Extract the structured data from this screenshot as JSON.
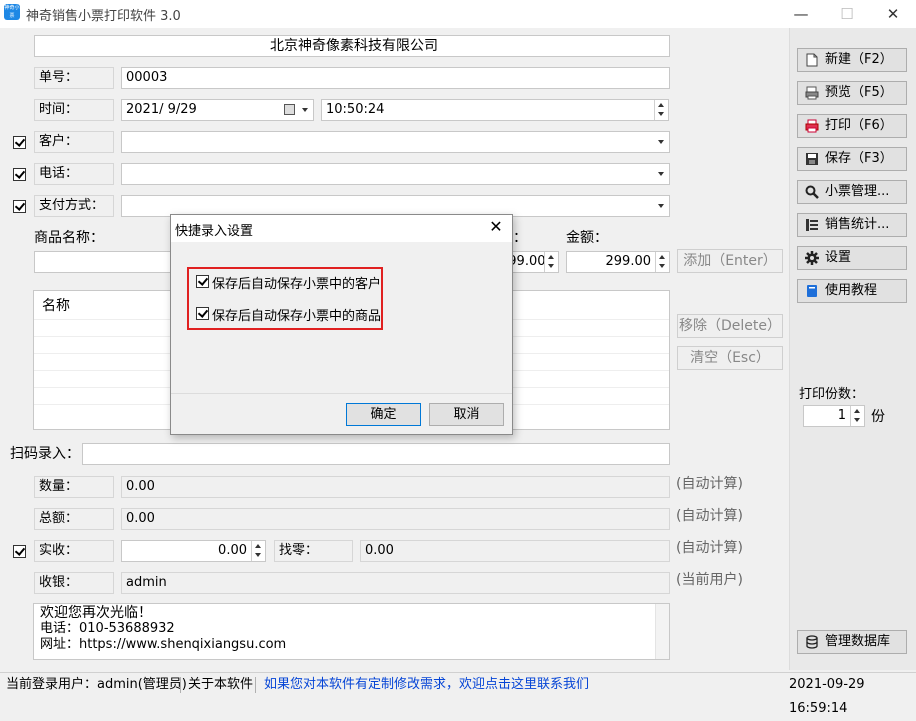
{
  "window": {
    "title": "神奇销售小票打印软件 3.0",
    "icon_text": "神奇小票",
    "minimize": "—",
    "maximize": "☐",
    "close": "✕"
  },
  "receipt": {
    "company": "北京神奇像素科技有限公司",
    "number_label": "单号：",
    "number_value": "00003",
    "time_label": "时间：",
    "date_value": "2021/ 9/29",
    "time_value": "10:50:24",
    "customer_label": "客户：",
    "customer_value": "",
    "phone_label": "电话：",
    "phone_value": "",
    "payment_label": "支付方式：",
    "payment_value": ""
  },
  "product": {
    "name_label": "商品名称：",
    "price_label": "：",
    "price_value": "299.00",
    "amount_label": "金额：",
    "amount_value": "299.00",
    "add_button": "添加（Enter）",
    "remove_button": "移除（Delete）",
    "clear_button": "清空（Esc）",
    "list_header_name": "名称"
  },
  "scan": {
    "label": "扫码录入：",
    "value": ""
  },
  "summary": {
    "qty_label": "数量：",
    "qty_value": "0.00",
    "total_label": "总额：",
    "total_value": "0.00",
    "received_label": "实收：",
    "received_value": "0.00",
    "change_label": "找零：",
    "change_value": "0.00",
    "cashier_label": "收银：",
    "cashier_value": "admin",
    "auto_calc": "(自动计算)",
    "current_user": "(当前用户)"
  },
  "footer_text": {
    "line1": "欢迎您再次光临！",
    "line2": "电话：010-53688932",
    "line3": "网址：https://www.shenqixiangsu.com"
  },
  "sidebar": {
    "new": "新建（F2）",
    "preview": "预览（F5）",
    "print": "打印（F6）",
    "save": "保存（F3）",
    "receipt_mgmt": "小票管理...",
    "sales_stats": "销售统计...",
    "settings": "设置",
    "tutorial": "使用教程",
    "copies_label": "打印份数：",
    "copies_value": "1",
    "copies_unit": "份",
    "db_mgmt": "管理数据库"
  },
  "dialog": {
    "title": "快捷录入设置",
    "close": "✕",
    "option1": "保存后自动保存小票中的客户",
    "option2": "保存后自动保存小票中的商品",
    "ok": "确定",
    "cancel": "取消"
  },
  "statusbar": {
    "user": "当前登录用户：admin(管理员)",
    "about": "关于本软件",
    "custom_link": "如果您对本软件有定制修改需求，欢迎点击这里联系我们",
    "datetime": "2021-09-29 16:59:14"
  },
  "colors": {
    "accent_blue": "#1e88e5",
    "link_blue": "#0645d6",
    "highlight_red": "#e02020"
  }
}
